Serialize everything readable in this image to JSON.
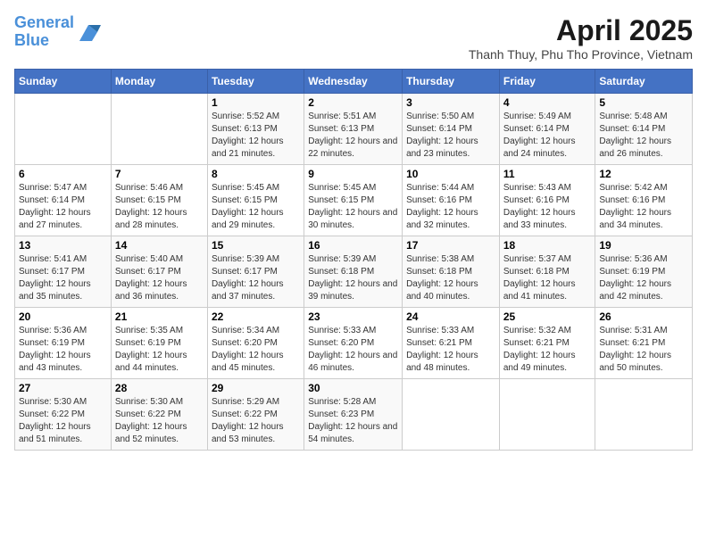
{
  "header": {
    "logo_line1": "General",
    "logo_line2": "Blue",
    "title": "April 2025",
    "subtitle": "Thanh Thuy, Phu Tho Province, Vietnam"
  },
  "days_of_week": [
    "Sunday",
    "Monday",
    "Tuesday",
    "Wednesday",
    "Thursday",
    "Friday",
    "Saturday"
  ],
  "weeks": [
    [
      {
        "day": "",
        "info": ""
      },
      {
        "day": "",
        "info": ""
      },
      {
        "day": "1",
        "info": "Sunrise: 5:52 AM\nSunset: 6:13 PM\nDaylight: 12 hours and 21 minutes."
      },
      {
        "day": "2",
        "info": "Sunrise: 5:51 AM\nSunset: 6:13 PM\nDaylight: 12 hours and 22 minutes."
      },
      {
        "day": "3",
        "info": "Sunrise: 5:50 AM\nSunset: 6:14 PM\nDaylight: 12 hours and 23 minutes."
      },
      {
        "day": "4",
        "info": "Sunrise: 5:49 AM\nSunset: 6:14 PM\nDaylight: 12 hours and 24 minutes."
      },
      {
        "day": "5",
        "info": "Sunrise: 5:48 AM\nSunset: 6:14 PM\nDaylight: 12 hours and 26 minutes."
      }
    ],
    [
      {
        "day": "6",
        "info": "Sunrise: 5:47 AM\nSunset: 6:14 PM\nDaylight: 12 hours and 27 minutes."
      },
      {
        "day": "7",
        "info": "Sunrise: 5:46 AM\nSunset: 6:15 PM\nDaylight: 12 hours and 28 minutes."
      },
      {
        "day": "8",
        "info": "Sunrise: 5:45 AM\nSunset: 6:15 PM\nDaylight: 12 hours and 29 minutes."
      },
      {
        "day": "9",
        "info": "Sunrise: 5:45 AM\nSunset: 6:15 PM\nDaylight: 12 hours and 30 minutes."
      },
      {
        "day": "10",
        "info": "Sunrise: 5:44 AM\nSunset: 6:16 PM\nDaylight: 12 hours and 32 minutes."
      },
      {
        "day": "11",
        "info": "Sunrise: 5:43 AM\nSunset: 6:16 PM\nDaylight: 12 hours and 33 minutes."
      },
      {
        "day": "12",
        "info": "Sunrise: 5:42 AM\nSunset: 6:16 PM\nDaylight: 12 hours and 34 minutes."
      }
    ],
    [
      {
        "day": "13",
        "info": "Sunrise: 5:41 AM\nSunset: 6:17 PM\nDaylight: 12 hours and 35 minutes."
      },
      {
        "day": "14",
        "info": "Sunrise: 5:40 AM\nSunset: 6:17 PM\nDaylight: 12 hours and 36 minutes."
      },
      {
        "day": "15",
        "info": "Sunrise: 5:39 AM\nSunset: 6:17 PM\nDaylight: 12 hours and 37 minutes."
      },
      {
        "day": "16",
        "info": "Sunrise: 5:39 AM\nSunset: 6:18 PM\nDaylight: 12 hours and 39 minutes."
      },
      {
        "day": "17",
        "info": "Sunrise: 5:38 AM\nSunset: 6:18 PM\nDaylight: 12 hours and 40 minutes."
      },
      {
        "day": "18",
        "info": "Sunrise: 5:37 AM\nSunset: 6:18 PM\nDaylight: 12 hours and 41 minutes."
      },
      {
        "day": "19",
        "info": "Sunrise: 5:36 AM\nSunset: 6:19 PM\nDaylight: 12 hours and 42 minutes."
      }
    ],
    [
      {
        "day": "20",
        "info": "Sunrise: 5:36 AM\nSunset: 6:19 PM\nDaylight: 12 hours and 43 minutes."
      },
      {
        "day": "21",
        "info": "Sunrise: 5:35 AM\nSunset: 6:19 PM\nDaylight: 12 hours and 44 minutes."
      },
      {
        "day": "22",
        "info": "Sunrise: 5:34 AM\nSunset: 6:20 PM\nDaylight: 12 hours and 45 minutes."
      },
      {
        "day": "23",
        "info": "Sunrise: 5:33 AM\nSunset: 6:20 PM\nDaylight: 12 hours and 46 minutes."
      },
      {
        "day": "24",
        "info": "Sunrise: 5:33 AM\nSunset: 6:21 PM\nDaylight: 12 hours and 48 minutes."
      },
      {
        "day": "25",
        "info": "Sunrise: 5:32 AM\nSunset: 6:21 PM\nDaylight: 12 hours and 49 minutes."
      },
      {
        "day": "26",
        "info": "Sunrise: 5:31 AM\nSunset: 6:21 PM\nDaylight: 12 hours and 50 minutes."
      }
    ],
    [
      {
        "day": "27",
        "info": "Sunrise: 5:30 AM\nSunset: 6:22 PM\nDaylight: 12 hours and 51 minutes."
      },
      {
        "day": "28",
        "info": "Sunrise: 5:30 AM\nSunset: 6:22 PM\nDaylight: 12 hours and 52 minutes."
      },
      {
        "day": "29",
        "info": "Sunrise: 5:29 AM\nSunset: 6:22 PM\nDaylight: 12 hours and 53 minutes."
      },
      {
        "day": "30",
        "info": "Sunrise: 5:28 AM\nSunset: 6:23 PM\nDaylight: 12 hours and 54 minutes."
      },
      {
        "day": "",
        "info": ""
      },
      {
        "day": "",
        "info": ""
      },
      {
        "day": "",
        "info": ""
      }
    ]
  ]
}
